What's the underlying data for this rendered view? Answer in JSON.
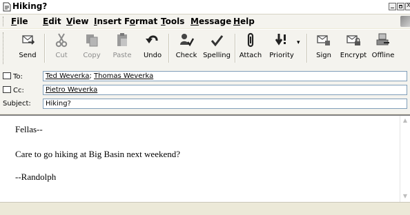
{
  "window": {
    "title": "Hiking?"
  },
  "menu": {
    "items": [
      {
        "pre": "",
        "u": "F",
        "post": "ile"
      },
      {
        "pre": "",
        "u": "E",
        "post": "dit"
      },
      {
        "pre": "",
        "u": "V",
        "post": "iew"
      },
      {
        "pre": "",
        "u": "I",
        "post": "nsert"
      },
      {
        "pre": "F",
        "u": "o",
        "post": "rmat"
      },
      {
        "pre": "",
        "u": "T",
        "post": "ools"
      },
      {
        "pre": "",
        "u": "M",
        "post": "essage"
      },
      {
        "pre": "",
        "u": "H",
        "post": "elp"
      }
    ]
  },
  "toolbar": {
    "send": "Send",
    "cut": "Cut",
    "copy": "Copy",
    "paste": "Paste",
    "undo": "Undo",
    "check": "Check",
    "spelling": "Spelling",
    "attach": "Attach",
    "priority": "Priority",
    "sign": "Sign",
    "encrypt": "Encrypt",
    "offline": "Offline"
  },
  "header": {
    "to_label": "To:",
    "to_recipients": [
      "Ted Weverka",
      "Thomas Weverka"
    ],
    "to_separator": ";",
    "cc_label": "Cc:",
    "cc_recipients": [
      "Pietro Weverka"
    ],
    "subject_label": "Subject:",
    "subject_value": "Hiking?"
  },
  "body": {
    "lines": [
      "Fellas--",
      "Care to go hiking at Big Basin next weekend?",
      "--Randolph"
    ]
  },
  "colors": {
    "chrome": "#ece9d8",
    "toolbar": "#f4f3ee",
    "field_border": "#7f9db9",
    "disabled_text": "#8c8c8c"
  }
}
